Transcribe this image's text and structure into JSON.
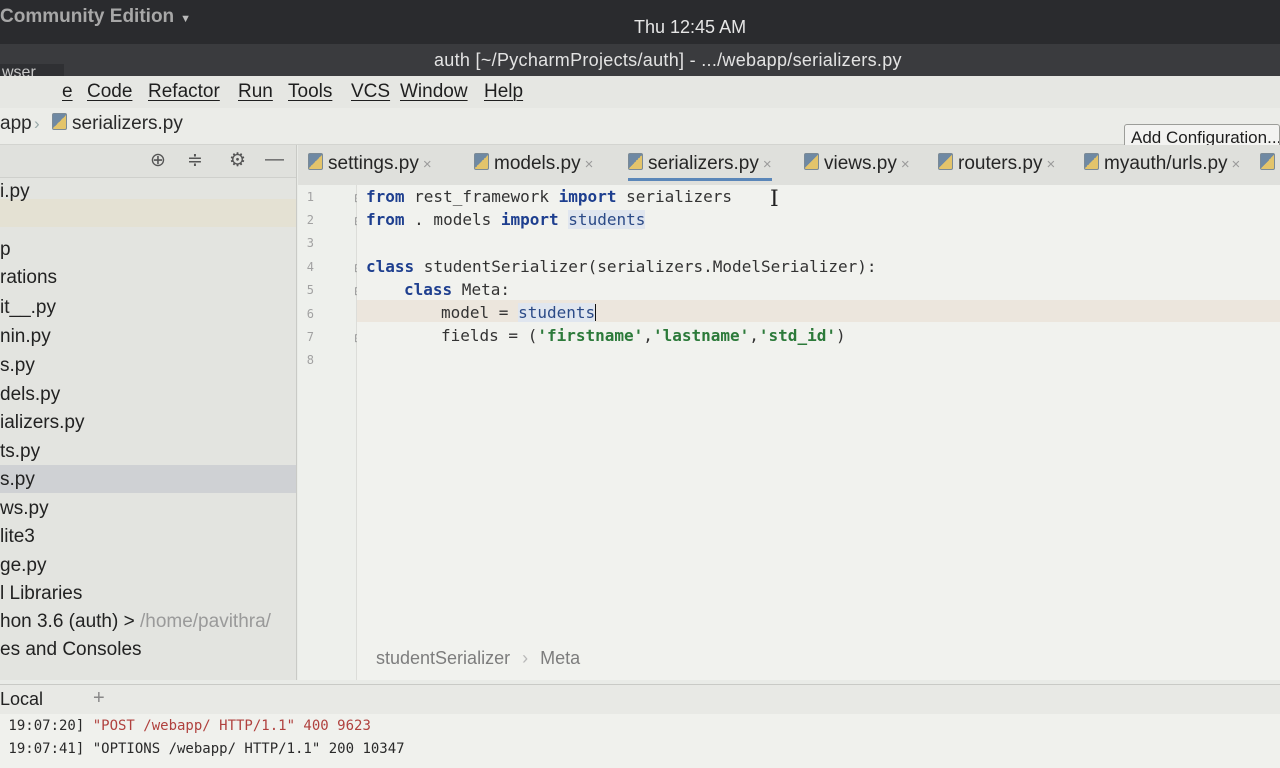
{
  "os_bar": {
    "app_menu": "Community Edition",
    "clock": "Thu 12:45 AM"
  },
  "window": {
    "title": "auth [~/PycharmProjects/auth] - .../webapp/serializers.py",
    "browser_chip": "wser"
  },
  "menu": {
    "items": [
      "e",
      "Code",
      "Refactor",
      "Run",
      "Tools",
      "VCS",
      "Window",
      "Help"
    ]
  },
  "nav": {
    "root": "app",
    "file": "serializers.py",
    "add_configuration": "Add Configuration..."
  },
  "project_panel": {
    "items": [
      "i.py",
      "p",
      "rations",
      "it__.py",
      "nin.py",
      "s.py",
      "dels.py",
      "ializers.py",
      "ts.py",
      "s.py",
      "ws.py",
      "lite3",
      "ge.py",
      "l Libraries",
      "hon 3.6 (auth) >",
      "es and Consoles"
    ],
    "python_path": "/home/pavithra/"
  },
  "tabs": [
    {
      "label": "settings.py"
    },
    {
      "label": "models.py"
    },
    {
      "label": "serializers.py",
      "active": true
    },
    {
      "label": "views.py"
    },
    {
      "label": "routers.py"
    },
    {
      "label": "myauth/urls.py"
    }
  ],
  "editor": {
    "line_numbers": [
      "1",
      "2",
      "3",
      "4",
      "5",
      "6",
      "7",
      "8"
    ],
    "code": {
      "l1_kw1": "from",
      "l1_mod": " rest_framework ",
      "l1_kw2": "import",
      "l1_name": " serializers",
      "l2_kw1": "from",
      "l2_mod": " . models ",
      "l2_kw2": "import",
      "l2_name": "students",
      "l4_kw": "class",
      "l4_rest": " studentSerializer(serializers.ModelSerializer):",
      "l5_kw": "class",
      "l5_rest": " Meta:",
      "l6_lhs": "model = ",
      "l6_rhs": "students",
      "l7_lhs": "fields = (",
      "l7_s1": "'firstname'",
      "l7_s2": "'lastname'",
      "l7_s3": "'std_id'",
      "l7_end": ")",
      "comma": ","
    },
    "breadcrumb": [
      "studentSerializer",
      "Meta"
    ]
  },
  "terminal": {
    "tab": "Local",
    "add": "+",
    "lines": [
      {
        "prefix": " 19:07:20] ",
        "text": "\"POST /webapp/ HTTP/1.1\" 400 9623"
      },
      {
        "prefix": " 19:07:41] ",
        "text": "\"OPTIONS /webapp/ HTTP/1.1\" 200 10347"
      }
    ]
  }
}
